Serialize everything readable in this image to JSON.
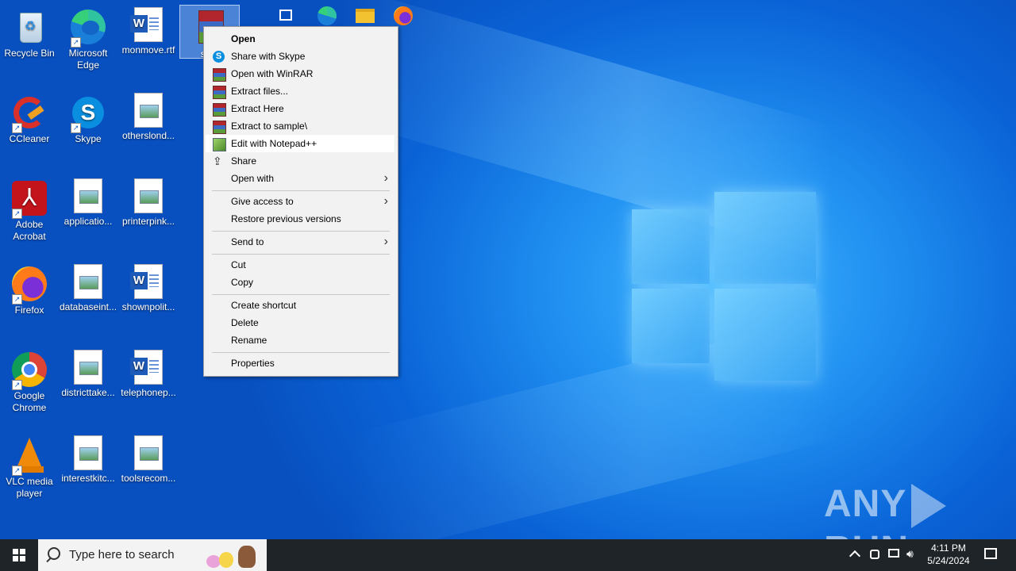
{
  "desktop_icons": [
    {
      "label": "Recycle Bin",
      "type": "recycle"
    },
    {
      "label": "Microsoft Edge",
      "type": "edge"
    },
    {
      "label": "monmove.rtf",
      "type": "word"
    },
    {
      "label": "sam",
      "type": "winrar"
    },
    {
      "label": "CCleaner",
      "type": "ccleaner"
    },
    {
      "label": "Skype",
      "type": "skype"
    },
    {
      "label": "otherslond...",
      "type": "image"
    },
    {
      "label": "Adobe Acrobat",
      "type": "acrobat"
    },
    {
      "label": "applicatio...",
      "type": "image"
    },
    {
      "label": "printerpink...",
      "type": "image"
    },
    {
      "label": "Firefox",
      "type": "firefox"
    },
    {
      "label": "databaseint...",
      "type": "image"
    },
    {
      "label": "shownpolit...",
      "type": "word"
    },
    {
      "label": "Google Chrome",
      "type": "chrome"
    },
    {
      "label": "districttake...",
      "type": "image"
    },
    {
      "label": "telephonep...",
      "type": "word"
    },
    {
      "label": "VLC media player",
      "type": "vlc"
    },
    {
      "label": "interestkitc...",
      "type": "image"
    },
    {
      "label": "toolsrecom...",
      "type": "image"
    }
  ],
  "context_menu": {
    "items": [
      {
        "label": "Open",
        "icon": "none"
      },
      {
        "label": "Share with Skype",
        "icon": "skype-icon"
      },
      {
        "label": "Open with WinRAR",
        "icon": "winrar-icon"
      },
      {
        "label": "Extract files...",
        "icon": "winrar-icon"
      },
      {
        "label": "Extract Here",
        "icon": "winrar-icon"
      },
      {
        "label": "Extract to sample\\",
        "icon": "winrar-icon"
      },
      {
        "label": "Edit with Notepad++",
        "icon": "notepadpp-icon"
      },
      {
        "label": "Share",
        "icon": "share-icon"
      },
      {
        "label": "Open with",
        "icon": "none"
      },
      {
        "label": "Give access to",
        "icon": "none"
      },
      {
        "label": "Restore previous versions",
        "icon": "none"
      },
      {
        "label": "Send to",
        "icon": "none"
      },
      {
        "label": "Cut",
        "icon": "none"
      },
      {
        "label": "Copy",
        "icon": "none"
      },
      {
        "label": "Create shortcut",
        "icon": "none"
      },
      {
        "label": "Delete",
        "icon": "none"
      },
      {
        "label": "Rename",
        "icon": "none"
      },
      {
        "label": "Properties",
        "icon": "none"
      }
    ]
  },
  "taskbar": {
    "search_placeholder": "Type here to search",
    "time": "4:11 PM",
    "date": "5/24/2024"
  },
  "watermark": {
    "left": "ANY",
    "right": "RUN"
  }
}
